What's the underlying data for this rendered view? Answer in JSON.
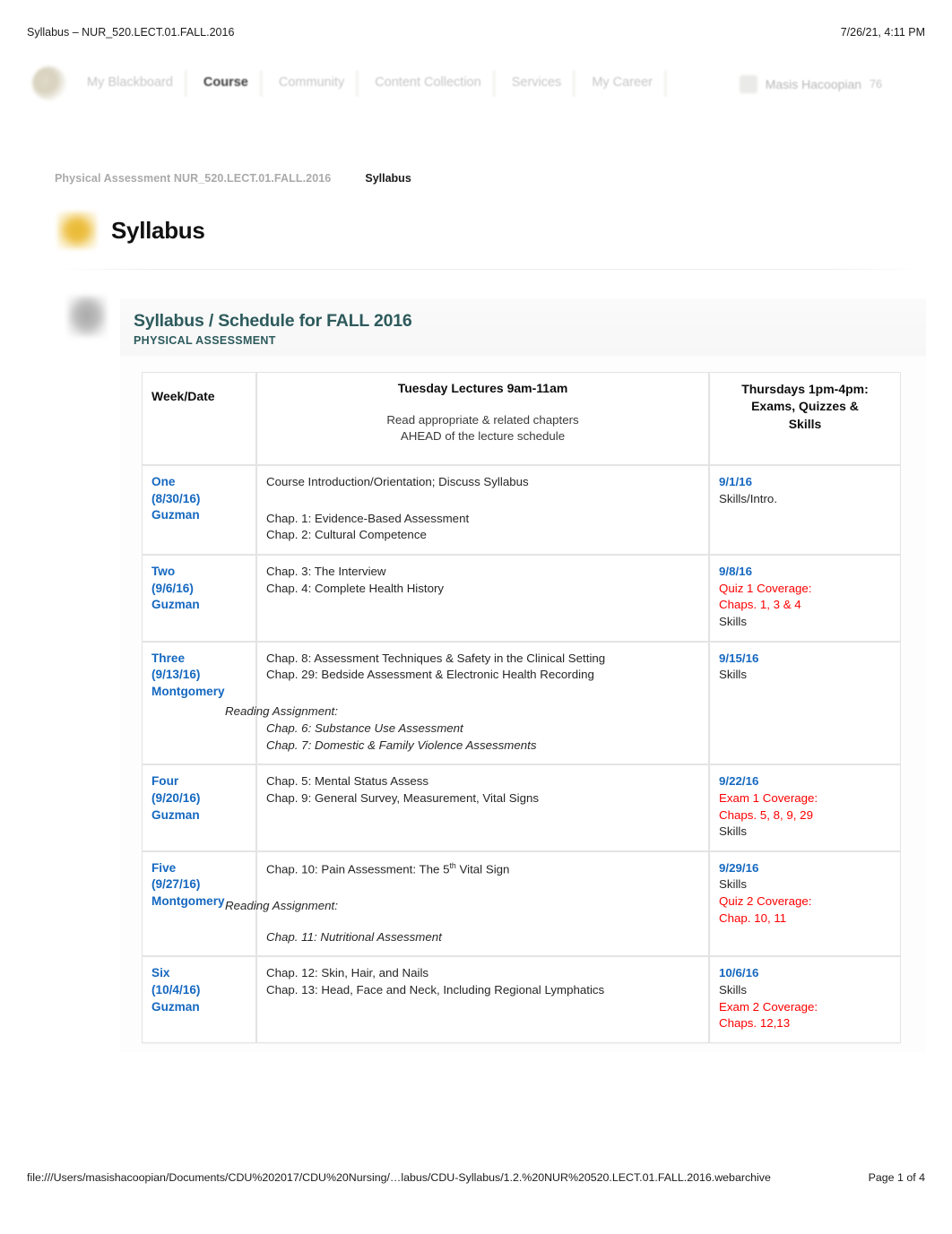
{
  "print_header": {
    "document_title": "Syllabus – NUR_520.LECT.01.FALL.2016",
    "timestamp": "7/26/21, 4:11 PM"
  },
  "nav": {
    "logo_icon": "blackboard-logo-icon",
    "tabs": [
      {
        "label": "My Blackboard",
        "active": false
      },
      {
        "label": "Course",
        "active": true
      },
      {
        "label": "Community",
        "active": false
      },
      {
        "label": "Content Collection",
        "active": false
      },
      {
        "label": "Services",
        "active": false
      },
      {
        "label": "My Career",
        "active": false
      }
    ],
    "user": {
      "name": "Masis Hacoopian",
      "count": "76",
      "avatar_icon": "avatar-icon"
    }
  },
  "breadcrumb": {
    "course": "Physical Assessment NUR_520.LECT.01.FALL.2016",
    "current": "Syllabus"
  },
  "page": {
    "title": "Syllabus",
    "folder_icon": "folder-icon",
    "document_icon": "document-icon"
  },
  "document": {
    "title": "Syllabus / Schedule for FALL 2016",
    "subtitle": "PHYSICAL ASSESSMENT",
    "accent_color": "#2d5a5c"
  },
  "colors": {
    "week_blue": "#1568c0",
    "exam_red": "#fd0000",
    "heading_teal": "#2d5a5c",
    "folder_gold": "#e7b830"
  },
  "table": {
    "headers": {
      "week": "Week/Date",
      "lecture_title": "Tuesday Lectures  9am-11am",
      "lecture_sub_line1": "Read appropriate & related chapters",
      "lecture_sub_line2": "AHEAD of the lecture schedule",
      "thursday_line1": "Thursdays 1pm-4pm:",
      "thursday_line2": "Exams,  Quizzes &",
      "thursday_line3": "Skills"
    },
    "rows": [
      {
        "week": "One",
        "date": "(8/30/16)",
        "instructor": "Guzman",
        "lecture_intro": "Course Introduction/Orientation; Discuss  Syllabus",
        "lecture_lines": [
          "Chap. 1: Evidence-Based Assessment",
          "Chap. 2: Cultural Competence"
        ],
        "reading_label": "",
        "reading_lines": [],
        "thu_date": "9/1/16",
        "thu_plain_before": "Skills/Intro.",
        "thu_red_lines": [],
        "thu_plain_after": ""
      },
      {
        "week": "Two",
        "date": "(9/6/16)",
        "instructor": "Guzman",
        "lecture_intro": "",
        "lecture_lines": [
          "Chap. 3: The Interview",
          "Chap. 4: Complete Health History"
        ],
        "reading_label": "",
        "reading_lines": [],
        "thu_date": "9/8/16",
        "thu_plain_before": "",
        "thu_red_lines": [
          "Quiz 1 Coverage:",
          "Chaps. 1, 3 & 4"
        ],
        "thu_plain_after": "Skills"
      },
      {
        "week": "Three",
        "date": "(9/13/16)",
        "instructor": "Montgomery",
        "lecture_intro": "",
        "lecture_lines": [
          "Chap. 8: Assessment Techniques & Safety in the Clinical Setting",
          "Chap. 29: Bedside Assessment & Electronic Health Recording"
        ],
        "reading_label": "Reading Assignment:",
        "reading_lines": [
          "Chap. 6: Substance Use  Assessment",
          "Chap. 7: Domestic & Family Violence Assessments"
        ],
        "thu_date": "9/15/16",
        "thu_plain_before": "Skills",
        "thu_red_lines": [],
        "thu_plain_after": ""
      },
      {
        "week": "Four",
        "date": "(9/20/16)",
        "instructor": "Guzman",
        "lecture_intro": "",
        "lecture_lines": [
          "Chap. 5: Mental Status Assess",
          "Chap. 9: General Survey, Measurement, Vital Signs"
        ],
        "reading_label": "",
        "reading_lines": [],
        "thu_date": "9/22/16",
        "thu_plain_before": "",
        "thu_red_lines": [
          "Exam  1 Coverage:",
          "Chaps. 5, 8, 9, 29"
        ],
        "thu_plain_after": "Skills"
      },
      {
        "week": "Five",
        "date": "(9/27/16)",
        "instructor": "Montgomery",
        "lecture_intro": "",
        "lecture_lines": [
          "Chap. 10: Pain Assessment: The 5th  Vital Sign"
        ],
        "reading_label": "Reading Assignment:",
        "reading_lines": [
          "Chap. 11: Nutritional Assessment"
        ],
        "thu_date": "9/29/16",
        "thu_plain_before": "Skills",
        "thu_red_lines": [
          "Quiz 2 Coverage:",
          "Chap. 10, 11"
        ],
        "thu_plain_after": ""
      },
      {
        "week": "Six",
        "date": "(10/4/16)",
        "instructor": "Guzman",
        "lecture_intro": "",
        "lecture_lines": [
          "Chap. 12: Skin, Hair, and Nails",
          "Chap. 13: Head, Face and Neck, Including Regional Lymphatics"
        ],
        "reading_label": "",
        "reading_lines": [],
        "thu_date": "10/6/16",
        "thu_plain_before": "Skills",
        "thu_red_lines": [
          "Exam  2 Coverage:",
          "Chaps.  12,13"
        ],
        "thu_plain_after": ""
      }
    ]
  },
  "print_footer": {
    "file_url": "file:///Users/masishacoopian/Documents/CDU%202017/CDU%20Nursing/…labus/CDU-Syllabus/1.2.%20NUR%20520.LECT.01.FALL.2016.webarchive",
    "page_number": "Page 1 of 4"
  }
}
